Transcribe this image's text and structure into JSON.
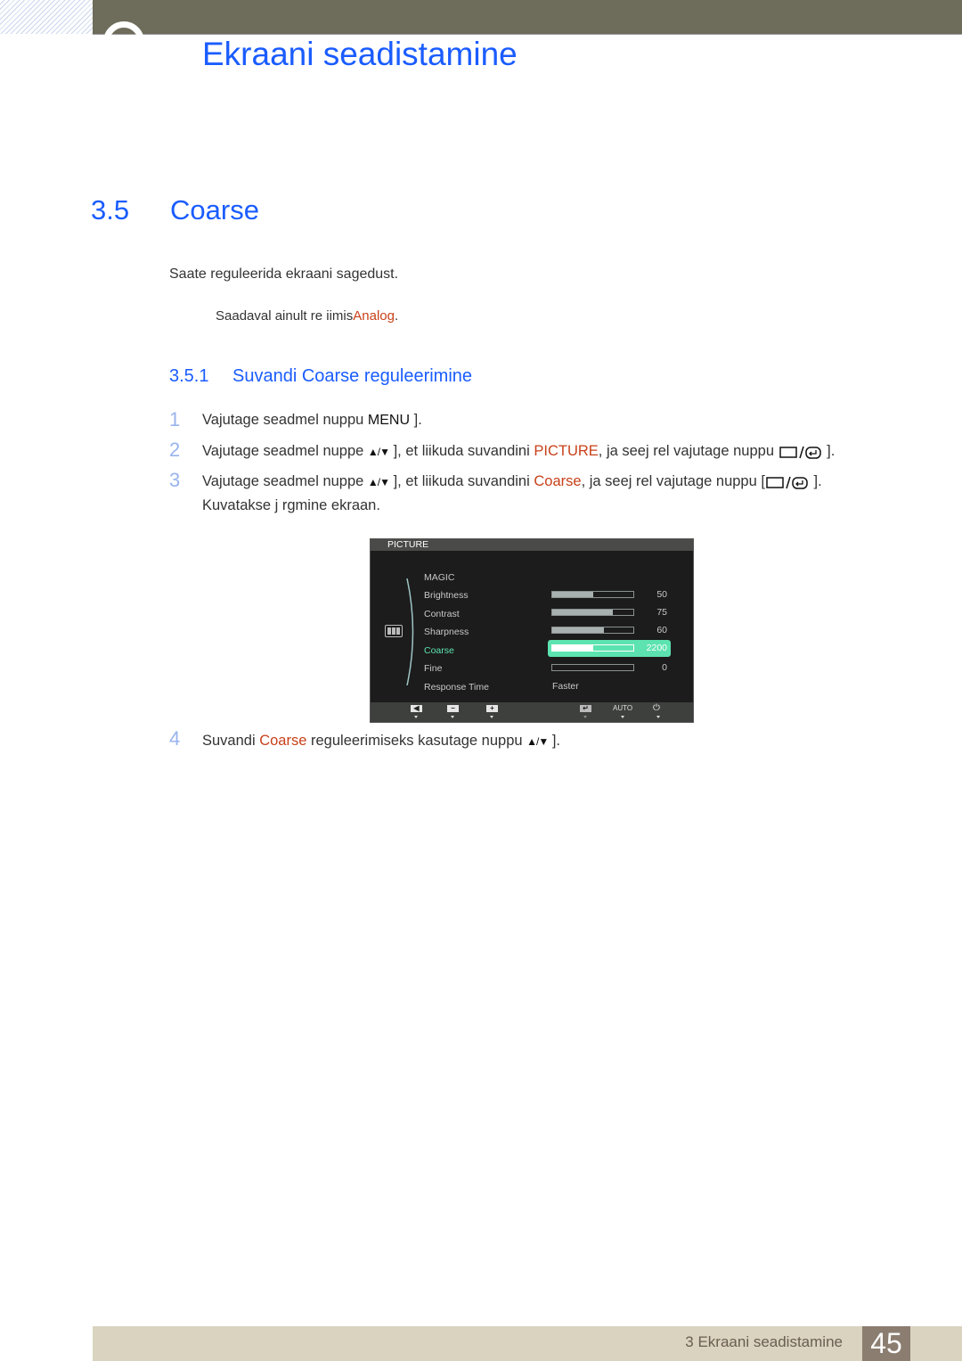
{
  "header": {
    "chapter_title": "Ekraani seadistamine"
  },
  "section": {
    "number": "3.5",
    "title": "Coarse",
    "intro": "Saate reguleerida ekraani sagedust.",
    "note_prefix": "Saadaval ainult re iimis",
    "note_highlight": "Analog",
    "note_suffix": "."
  },
  "subsection": {
    "number": "3.5.1",
    "title": "Suvandi Coarse reguleerimine"
  },
  "steps": [
    {
      "n": "1",
      "a": "Vajutage seadmel nuppu ",
      "menu": "MENU",
      "b": " ]."
    },
    {
      "n": "2",
      "a": "Vajutage seadmel nuppe ",
      "ud": "▲/▼",
      "b": " ], et liikuda suvandini ",
      "hl": "PICTURE",
      "c": ", ja seej rel vajutage nuppu ",
      "d": " ]."
    },
    {
      "n": "3",
      "a": "Vajutage seadmel nuppe ",
      "ud": "▲/▼",
      "b": " ], et liikuda suvandini ",
      "hl": "Coarse",
      "c": ", ja seej rel vajutage nuppu [",
      "d": " ].",
      "line2": "Kuvatakse j rgmine ekraan."
    },
    {
      "n": "4",
      "a": "Suvandi ",
      "hl": "Coarse",
      "b": " reguleerimiseks kasutage nuppu ",
      "ud": "▲/▼",
      "c": " ]."
    }
  ],
  "osd": {
    "header": "PICTURE",
    "items": [
      {
        "label": "MAGIC"
      },
      {
        "label": "Brightness",
        "value": "50",
        "fraction": 0.5
      },
      {
        "label": "Contrast",
        "value": "75",
        "fraction": 0.75
      },
      {
        "label": "Sharpness",
        "value": "60",
        "fraction": 0.64
      },
      {
        "label": "Coarse",
        "value": "2200",
        "fraction": 0.5,
        "selected": true
      },
      {
        "label": "Fine",
        "value": "0",
        "fraction": 0
      },
      {
        "label": "Response Time",
        "value": "Faster"
      }
    ],
    "footer": {
      "left_icon": "◀",
      "minus_icon": "−",
      "plus_icon": "+",
      "enter_icon": "↵",
      "auto": "AUTO",
      "power_icon": "⏻"
    },
    "accent": "#5de3b0"
  },
  "footer": {
    "text": "3 Ekraani seadistamine",
    "page": "45"
  }
}
